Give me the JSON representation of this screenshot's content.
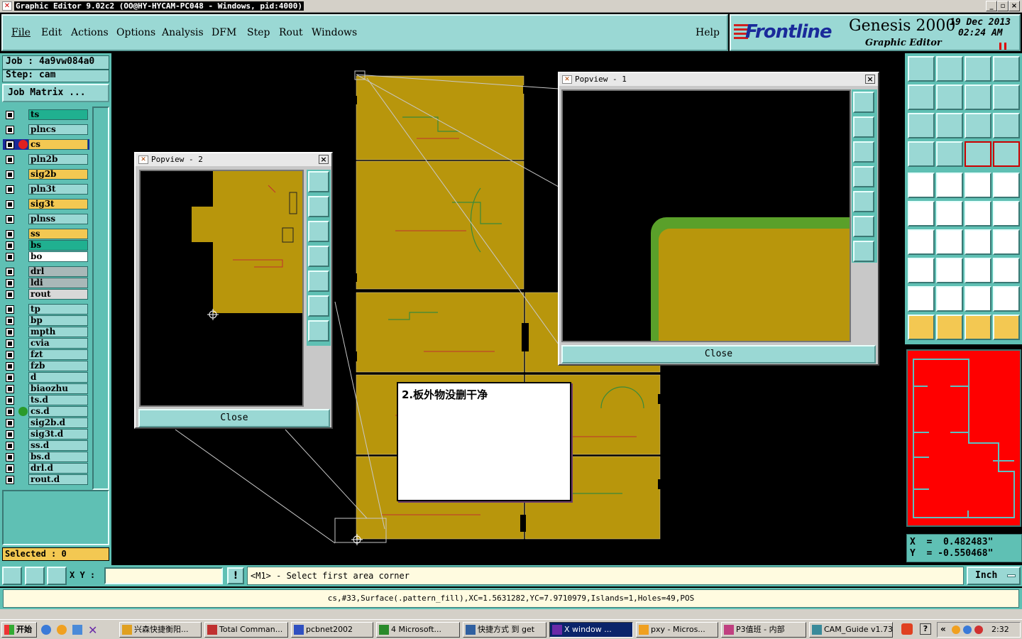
{
  "window": {
    "title": "Graphic Editor 9.02c2 (OO@HY-HYCAM-PC048 - Windows, pid:4000)"
  },
  "menu": [
    "File",
    "Edit",
    "Actions",
    "Options",
    "Analysis",
    "DFM",
    "Step",
    "Rout",
    "Windows"
  ],
  "help_label": "Help",
  "brand": {
    "logo": "Frontline",
    "product": "Genesis 2000",
    "subtitle": "Graphic Editor",
    "date": "19 Dec 2013",
    "time": "02:24 AM"
  },
  "job": {
    "label": "Job : 4a9vw084a0",
    "step": "Step: cam",
    "matrix_button": "Job Matrix ..."
  },
  "layers": [
    {
      "name": "ts",
      "color": "#20b090"
    },
    {
      "name": "plncs",
      "color": "#9ad8d4"
    },
    {
      "name": "cs",
      "color": "#f3c852",
      "active": true
    },
    {
      "name": "pln2b",
      "color": "#9ad8d4"
    },
    {
      "name": "sig2b",
      "color": "#f3c852"
    },
    {
      "name": "pln3t",
      "color": "#9ad8d4"
    },
    {
      "name": "sig3t",
      "color": "#f3c852"
    },
    {
      "name": "plnss",
      "color": "#9ad8d4"
    },
    {
      "name": "ss",
      "color": "#f3c852"
    },
    {
      "name": "bs",
      "color": "#20b090"
    },
    {
      "name": "bo",
      "color": "#ffffff"
    },
    {
      "name": "drl",
      "color": "#a8b8b8"
    },
    {
      "name": "ldi",
      "color": "#a8b8b8"
    },
    {
      "name": "rout",
      "color": "#d8d8d8"
    },
    {
      "name": "tp",
      "color": "#9ad8d4"
    },
    {
      "name": "bp",
      "color": "#9ad8d4"
    },
    {
      "name": "mpth",
      "color": "#9ad8d4"
    },
    {
      "name": "cvia",
      "color": "#9ad8d4"
    },
    {
      "name": "fzt",
      "color": "#9ad8d4"
    },
    {
      "name": "fzb",
      "color": "#9ad8d4"
    },
    {
      "name": "d",
      "color": "#9ad8d4"
    },
    {
      "name": "biaozhu",
      "color": "#9ad8d4"
    },
    {
      "name": "ts.d",
      "color": "#9ad8d4"
    },
    {
      "name": "cs.d",
      "color": "#9ad8d4",
      "marker": true
    },
    {
      "name": "sig2b.d",
      "color": "#9ad8d4"
    },
    {
      "name": "sig3t.d",
      "color": "#9ad8d4"
    },
    {
      "name": "ss.d",
      "color": "#9ad8d4"
    },
    {
      "name": "bs.d",
      "color": "#9ad8d4"
    },
    {
      "name": "drl.d",
      "color": "#9ad8d4"
    },
    {
      "name": "rout.d",
      "color": "#9ad8d4"
    }
  ],
  "selected": "Selected : 0",
  "popview1": {
    "title": "Popview - 1",
    "close": "Close"
  },
  "popview2": {
    "title": "Popview - 2",
    "close": "Close"
  },
  "note": "2.板外物没删干净",
  "coords": {
    "x": "X  =  0.482483\"",
    "y": "Y  = -0.550468\""
  },
  "status": {
    "xy_label": "X Y :",
    "xy_value": "",
    "prompt": "<M1> - Select first area corner",
    "units": "Inch"
  },
  "info": "cs,#33,Surface(.pattern_fill),XC=1.5631282,YC=7.9710979,Islands=1,Holes=49,POS",
  "taskbar": {
    "start": "开始",
    "tasks": [
      "兴森快捷衡阳...",
      "Total Comman...",
      "pcbnet2002",
      "4 Microsoft...",
      "快捷方式 到 get",
      "X window ...",
      "pxy - Micros...",
      "P3值班 - 内部",
      "CAM_Guide v1.73"
    ],
    "clock": "2:32"
  },
  "colors": {
    "board": "#b8960c",
    "menu": "#9ad8d4",
    "panel": "#5fc0b4",
    "highlight": "#f3c852",
    "minimap": "#ff0000"
  }
}
